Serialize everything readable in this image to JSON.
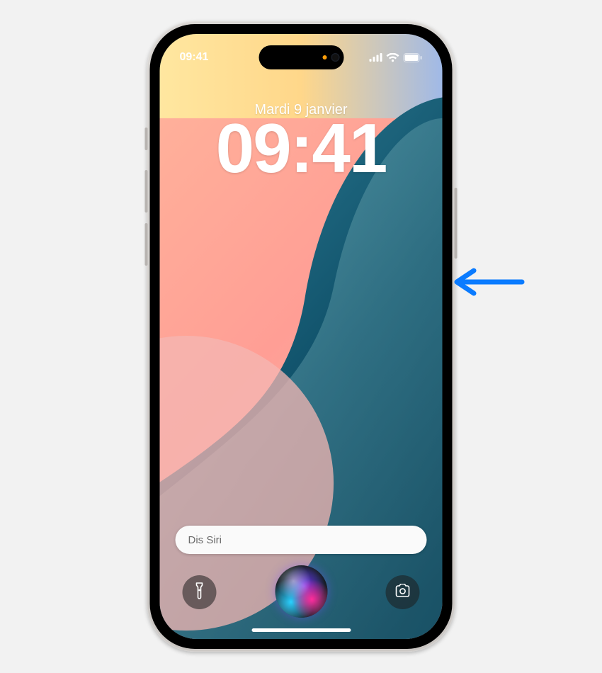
{
  "status": {
    "time": "09:41"
  },
  "lock": {
    "date": "Mardi 9 janvier",
    "time": "09:41"
  },
  "siri": {
    "prompt": "Dis Siri"
  },
  "icons": {
    "cellular": "cellular-icon",
    "wifi": "wifi-icon",
    "battery": "battery-icon",
    "flashlight": "flashlight-icon",
    "camera": "camera-icon",
    "siri_orb": "siri-orb-icon",
    "arrow": "annotation-arrow-icon"
  },
  "annotation": {
    "target": "side-button"
  }
}
